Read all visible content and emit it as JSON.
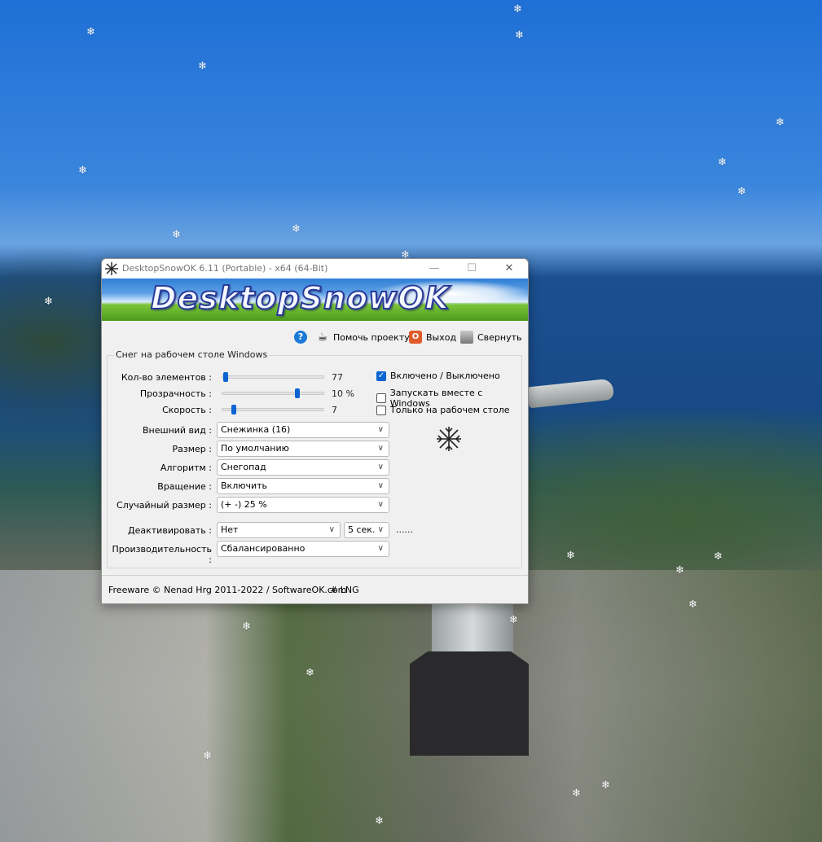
{
  "window": {
    "title": "DesktopSnowOK 6.11 (Portable) - x64 (64-Bit)",
    "banner_text": "DesktopSnowOK",
    "controls": {
      "minimize": "—",
      "maximize": "☐",
      "close": "✕"
    }
  },
  "toolbar": {
    "help_label": "?",
    "donate_label": "Помочь проекту",
    "exit_label": "Выход",
    "minimize_label": "Свернуть"
  },
  "group": {
    "title": "Снег на рабочем столе Windows",
    "sliders": [
      {
        "label": "Кол-во элементов :",
        "value_text": "77",
        "fraction": 0.02
      },
      {
        "label": "Прозрачность :",
        "value_text": "10 %",
        "fraction": 0.75
      },
      {
        "label": "Скорость :",
        "value_text": "7",
        "fraction": 0.1
      }
    ],
    "checkboxes": [
      {
        "label": "Включено / Выключено",
        "checked": true
      },
      {
        "label": "Запускать вместе с Windows",
        "checked": false
      },
      {
        "label": "Только на рабочем столе",
        "checked": false
      }
    ],
    "combos": {
      "appearance": {
        "label": "Внешний вид :",
        "value": "Снежинка (16)"
      },
      "size": {
        "label": "Размер :",
        "value": "По умолчанию"
      },
      "algorithm": {
        "label": "Алгоритм :",
        "value": "Снегопад"
      },
      "rotation": {
        "label": "Вращение :",
        "value": "Включить"
      },
      "random_size": {
        "label": "Случайный размер :",
        "value": "(+ -) 25 %"
      },
      "deactivate": {
        "label": "Деактивировать :",
        "value": "Нет",
        "interval": "5 сек.",
        "dots": "......"
      },
      "performance": {
        "label": "Производительность :",
        "value": "Сбалансированно"
      }
    }
  },
  "footer": {
    "text": "Freeware © Nenad Hrg 2011-2022 / SoftwareOK.com",
    "lng": "# LNG"
  },
  "icons": {
    "snowflake": "❄",
    "help": "help-icon",
    "donate": "coffee-cup-icon",
    "exit": "exit-icon",
    "minimize": "minimize-icon"
  }
}
